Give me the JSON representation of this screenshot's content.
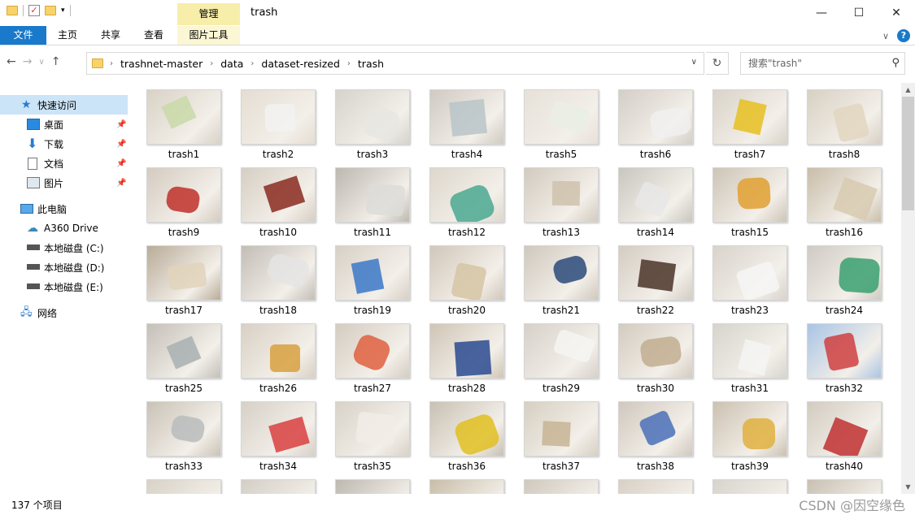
{
  "window": {
    "title": "trash",
    "context_tab": "管理",
    "minimize": "—",
    "maximize": "☐",
    "close": "✕"
  },
  "ribbon": {
    "tabs": [
      "文件",
      "主页",
      "共享",
      "查看",
      "图片工具"
    ],
    "expand": "∨",
    "help": "?"
  },
  "nav": {
    "back": "←",
    "forward": "→",
    "recent": "∨",
    "up": "↑"
  },
  "address": {
    "crumbs": [
      "trashnet-master",
      "data",
      "dataset-resized",
      "trash"
    ],
    "separator": "›",
    "dropdown": "∨",
    "refresh": "↻"
  },
  "search": {
    "placeholder": "搜索\"trash\"",
    "icon": "⚲"
  },
  "sidebar": {
    "items": [
      {
        "label": "快速访问",
        "icon": "star-icon",
        "pinned": false
      },
      {
        "label": "桌面",
        "icon": "desktop-icon",
        "pinned": true
      },
      {
        "label": "下载",
        "icon": "download-icon",
        "pinned": true
      },
      {
        "label": "文档",
        "icon": "document-icon",
        "pinned": true
      },
      {
        "label": "图片",
        "icon": "pictures-icon",
        "pinned": true
      },
      {
        "label": "此电脑",
        "icon": "computer-icon",
        "pinned": false
      },
      {
        "label": "A360 Drive",
        "icon": "cloud-drive-icon",
        "pinned": false
      },
      {
        "label": "本地磁盘 (C:)",
        "icon": "drive-icon",
        "pinned": false
      },
      {
        "label": "本地磁盘 (D:)",
        "icon": "drive-icon",
        "pinned": false
      },
      {
        "label": "本地磁盘 (E:)",
        "icon": "drive-icon",
        "pinned": false
      },
      {
        "label": "网络",
        "icon": "network-icon",
        "pinned": false
      }
    ]
  },
  "files": [
    "trash1",
    "trash2",
    "trash3",
    "trash4",
    "trash5",
    "trash6",
    "trash7",
    "trash8",
    "trash9",
    "trash10",
    "trash11",
    "trash12",
    "trash13",
    "trash14",
    "trash15",
    "trash16",
    "trash17",
    "trash18",
    "trash19",
    "trash20",
    "trash21",
    "trash22",
    "trash23",
    "trash24",
    "trash25",
    "trash26",
    "trash27",
    "trash28",
    "trash29",
    "trash30",
    "trash31",
    "trash32",
    "trash33",
    "trash34",
    "trash35",
    "trash36",
    "trash37",
    "trash38",
    "trash39",
    "trash40"
  ],
  "status": {
    "item_count": "137 个项目"
  },
  "watermark": "CSDN @因空缘色"
}
